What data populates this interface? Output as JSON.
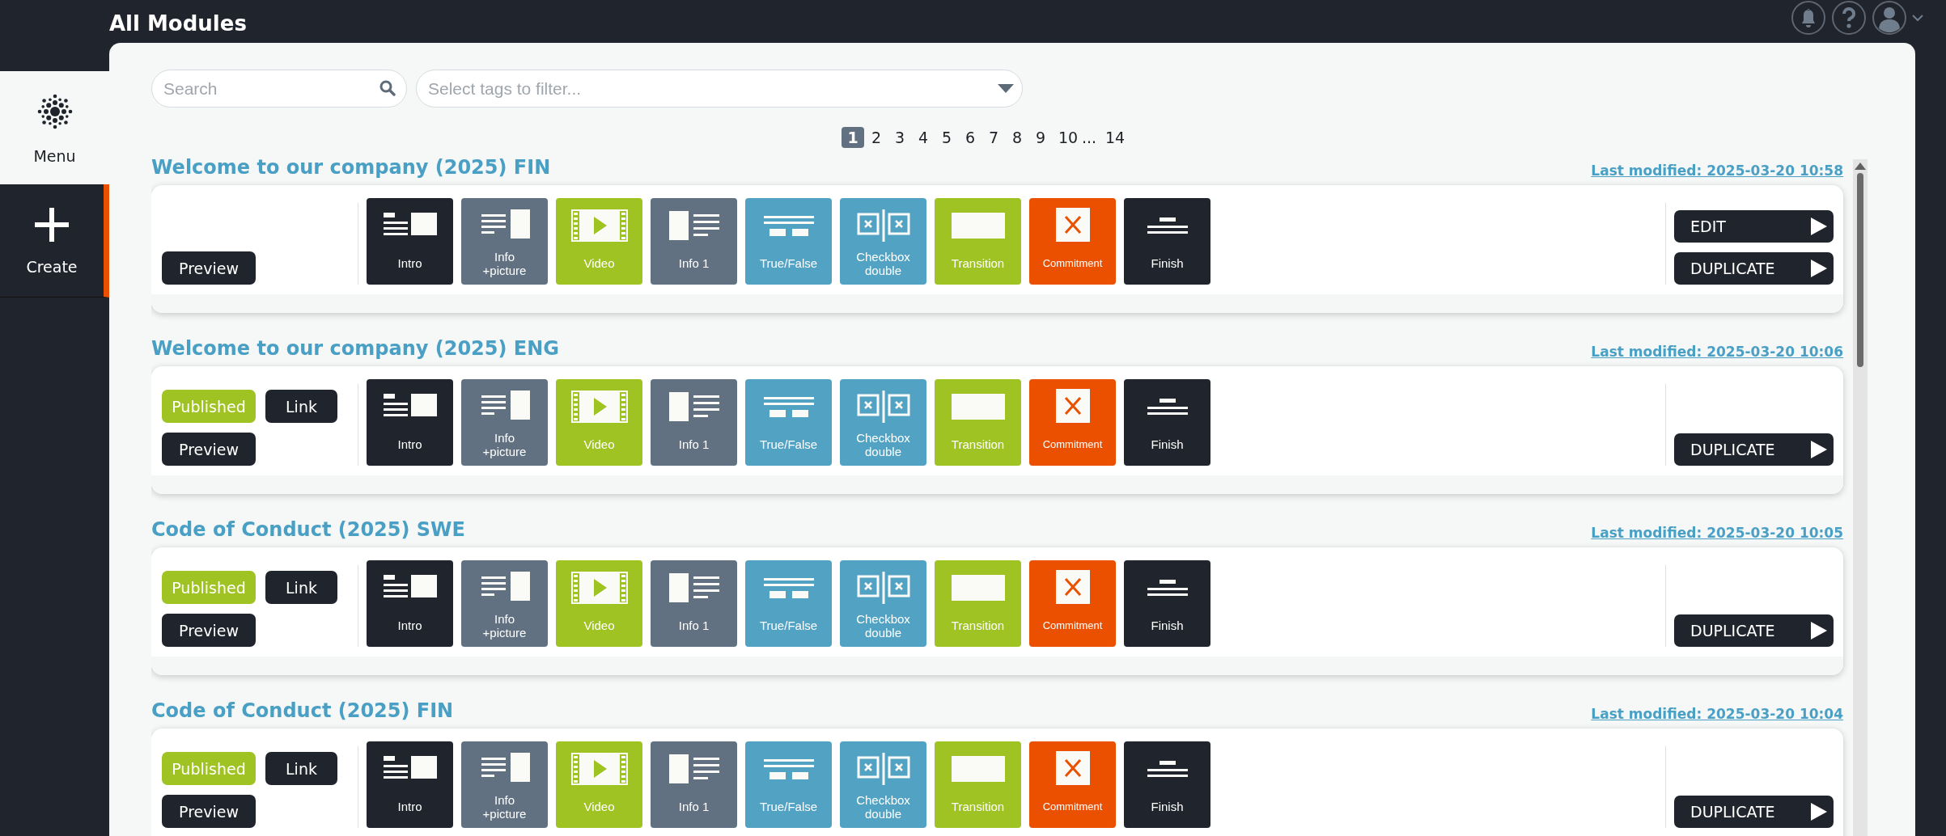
{
  "header": {
    "title": "All Modules"
  },
  "sidebar": {
    "items": [
      {
        "kind": "menu",
        "label": "Menu",
        "selected": false
      },
      {
        "kind": "create",
        "label": "Create",
        "selected": true
      }
    ]
  },
  "search": {
    "placeholder": "Search"
  },
  "tag_filter": {
    "placeholder": "Select tags to filter..."
  },
  "pagination": {
    "pages": [
      {
        "label": "1",
        "selected": true
      },
      {
        "label": "2",
        "selected": false
      },
      {
        "label": "3",
        "selected": false
      },
      {
        "label": "4",
        "selected": false
      },
      {
        "label": "5",
        "selected": false
      },
      {
        "label": "6",
        "selected": false
      },
      {
        "label": "7",
        "selected": false
      },
      {
        "label": "8",
        "selected": false
      },
      {
        "label": "9",
        "selected": false
      },
      {
        "label": "10",
        "selected": false
      },
      {
        "label": "...",
        "selected": false
      },
      {
        "label": "14",
        "selected": false
      }
    ]
  },
  "modules": [
    {
      "title": "Welcome to our company (2025) FIN",
      "last_modified": "Last modified: 2025-03-20 10:58",
      "actions": [
        {
          "kind": "preview",
          "label": "Preview"
        }
      ],
      "buttons": [
        "EDIT",
        "DUPLICATE"
      ],
      "tiles": [
        {
          "kind": "intro",
          "label": "Intro"
        },
        {
          "kind": "info-picture",
          "label": "Info +picture"
        },
        {
          "kind": "video",
          "label": "Video"
        },
        {
          "kind": "info",
          "label": "Info 1"
        },
        {
          "kind": "true-false",
          "label": "True/False"
        },
        {
          "kind": "checkbox-double",
          "label": "Checkbox double"
        },
        {
          "kind": "transition",
          "label": "Transition"
        },
        {
          "kind": "commitment",
          "label": "Commitment"
        },
        {
          "kind": "finish",
          "label": "Finish"
        }
      ]
    },
    {
      "title": "Welcome to our company (2025) ENG",
      "last_modified": "Last modified: 2025-03-20 10:06",
      "actions": [
        {
          "kind": "status",
          "label": "Published"
        },
        {
          "kind": "link",
          "label": "Link"
        },
        {
          "kind": "preview",
          "label": "Preview"
        }
      ],
      "buttons": [
        "DUPLICATE"
      ],
      "tiles": [
        {
          "kind": "intro",
          "label": "Intro"
        },
        {
          "kind": "info-picture",
          "label": "Info +picture"
        },
        {
          "kind": "video",
          "label": "Video"
        },
        {
          "kind": "info",
          "label": "Info 1"
        },
        {
          "kind": "true-false",
          "label": "True/False"
        },
        {
          "kind": "checkbox-double",
          "label": "Checkbox double"
        },
        {
          "kind": "transition",
          "label": "Transition"
        },
        {
          "kind": "commitment",
          "label": "Commitment"
        },
        {
          "kind": "finish",
          "label": "Finish"
        }
      ]
    },
    {
      "title": "Code of Conduct (2025) SWE",
      "last_modified": "Last modified: 2025-03-20 10:05",
      "actions": [
        {
          "kind": "status",
          "label": "Published"
        },
        {
          "kind": "link",
          "label": "Link"
        },
        {
          "kind": "preview",
          "label": "Preview"
        }
      ],
      "buttons": [
        "DUPLICATE"
      ],
      "tiles": [
        {
          "kind": "intro",
          "label": "Intro"
        },
        {
          "kind": "info-picture",
          "label": "Info +picture"
        },
        {
          "kind": "video",
          "label": "Video"
        },
        {
          "kind": "info",
          "label": "Info 1"
        },
        {
          "kind": "true-false",
          "label": "True/False"
        },
        {
          "kind": "checkbox-double",
          "label": "Checkbox double"
        },
        {
          "kind": "transition",
          "label": "Transition"
        },
        {
          "kind": "commitment",
          "label": "Commitment"
        },
        {
          "kind": "finish",
          "label": "Finish"
        }
      ]
    },
    {
      "title": "Code of Conduct (2025) FIN",
      "last_modified": "Last modified: 2025-03-20 10:04",
      "actions": [
        {
          "kind": "status",
          "label": "Published"
        },
        {
          "kind": "link",
          "label": "Link"
        },
        {
          "kind": "preview",
          "label": "Preview"
        }
      ],
      "buttons": [
        "DUPLICATE"
      ],
      "tiles": [
        {
          "kind": "intro",
          "label": "Intro"
        },
        {
          "kind": "info-picture",
          "label": "Info +picture"
        },
        {
          "kind": "video",
          "label": "Video"
        },
        {
          "kind": "info",
          "label": "Info 1"
        },
        {
          "kind": "true-false",
          "label": "True/False"
        },
        {
          "kind": "checkbox-double",
          "label": "Checkbox double"
        },
        {
          "kind": "transition",
          "label": "Transition"
        },
        {
          "kind": "commitment",
          "label": "Commitment"
        },
        {
          "kind": "finish",
          "label": "Finish"
        }
      ]
    }
  ]
}
